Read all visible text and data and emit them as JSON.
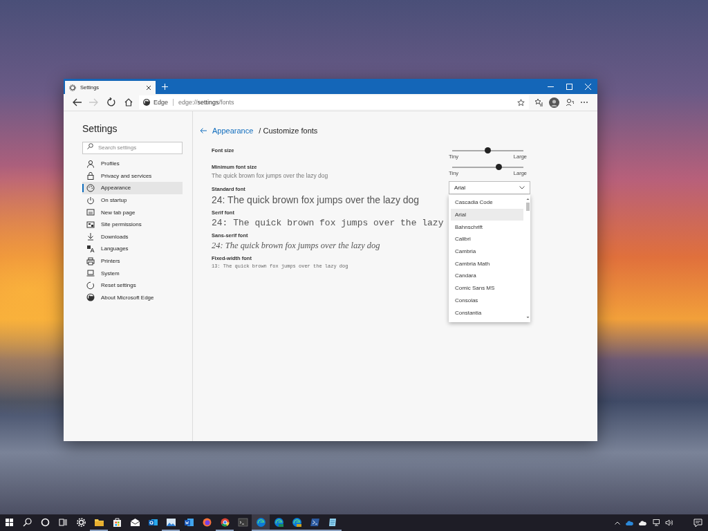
{
  "browser": {
    "tab": {
      "title": "Settings"
    },
    "nav_buttons": [
      {
        "kind": "back",
        "disabled": false
      },
      {
        "kind": "forward",
        "disabled": true
      },
      {
        "kind": "refresh",
        "disabled": false
      },
      {
        "kind": "home",
        "disabled": false
      }
    ],
    "address": {
      "site": "Edge",
      "url": "edge://**settings**/fonts"
    }
  },
  "sidebar": {
    "title": "Settings",
    "search": {
      "placeholder": "Search settings"
    },
    "items": [
      {
        "label": "Profiles",
        "selected": false
      },
      {
        "label": "Privacy and services",
        "selected": false
      },
      {
        "label": "Appearance",
        "selected": true
      },
      {
        "label": "On startup",
        "selected": false
      },
      {
        "label": "New tab page",
        "selected": false
      },
      {
        "label": "Site permissions",
        "selected": false
      },
      {
        "label": "Downloads",
        "selected": false
      },
      {
        "label": "Languages",
        "selected": false
      },
      {
        "label": "Printers",
        "selected": false
      },
      {
        "label": "System",
        "selected": false
      },
      {
        "label": "Reset settings",
        "selected": false
      },
      {
        "label": "About Microsoft Edge",
        "selected": false
      }
    ]
  },
  "page": {
    "back_link": "Appearance",
    "title": "/ Customize fonts",
    "rows": [
      {
        "kind": "slider",
        "label": "Font size",
        "level": 0.5,
        "min_label": "Tiny",
        "max_label": "Large"
      },
      {
        "kind": "slider",
        "label": "Minimum font size",
        "sample": "The quick brown fox jumps over the lazy dog",
        "level": 0.66,
        "min_label": "Tiny",
        "max_label": "Large"
      },
      {
        "kind": "dropdown",
        "label": "Standard font",
        "sample": "24: The quick brown fox jumps over the lazy dog",
        "value": "Arial",
        "expanded": true,
        "options": [
          {
            "label": "Cascadia Code",
            "selected": false
          },
          {
            "label": "Arial",
            "selected": true
          },
          {
            "label": "Bahnschrift",
            "selected": false
          },
          {
            "label": "Calibri",
            "selected": false
          },
          {
            "label": "Cambria",
            "selected": false
          },
          {
            "label": "Cambria Math",
            "selected": false
          },
          {
            "label": "Candara",
            "selected": false
          },
          {
            "label": "Comic Sans MS",
            "selected": false
          },
          {
            "label": "Consolas",
            "selected": false
          },
          {
            "label": "Constantia",
            "selected": false
          }
        ]
      },
      {
        "kind": "plain",
        "label": "Serif font",
        "sample": "24: The quick brown fox jumps over the lazy"
      },
      {
        "kind": "plain",
        "label": "Sans-serif font",
        "sample": "24: The quick brown fox jumps over the lazy dog"
      },
      {
        "kind": "plain",
        "label": "Fixed-width font",
        "sample": "13: The quick brown fox jumps over the lazy dog"
      }
    ]
  },
  "taskbar": {
    "apps": [
      {
        "kind": "start",
        "running": false,
        "selected": false
      },
      {
        "kind": "search",
        "running": false,
        "selected": false
      },
      {
        "kind": "cortana",
        "running": false,
        "selected": false
      },
      {
        "kind": "taskview",
        "running": false,
        "selected": false
      },
      {
        "kind": "settings",
        "running": false,
        "selected": false
      },
      {
        "kind": "explorer",
        "running": true,
        "selected": false
      },
      {
        "kind": "store",
        "running": false,
        "selected": false
      },
      {
        "kind": "mail",
        "running": false,
        "selected": false
      },
      {
        "kind": "outlook",
        "running": false,
        "selected": false
      },
      {
        "kind": "photos",
        "running": true,
        "selected": false
      },
      {
        "kind": "word",
        "running": false,
        "selected": false
      },
      {
        "kind": "firefox",
        "running": false,
        "selected": false
      },
      {
        "kind": "chrome",
        "running": true,
        "selected": false
      },
      {
        "kind": "terminal",
        "running": false,
        "selected": false
      },
      {
        "kind": "edge",
        "running": true,
        "selected": true
      },
      {
        "kind": "edge_beta",
        "running": true,
        "selected": false
      },
      {
        "kind": "edge_dev",
        "running": true,
        "selected": false
      },
      {
        "kind": "powershell",
        "running": true,
        "selected": false
      },
      {
        "kind": "notepad",
        "running": true,
        "selected": false
      }
    ]
  }
}
